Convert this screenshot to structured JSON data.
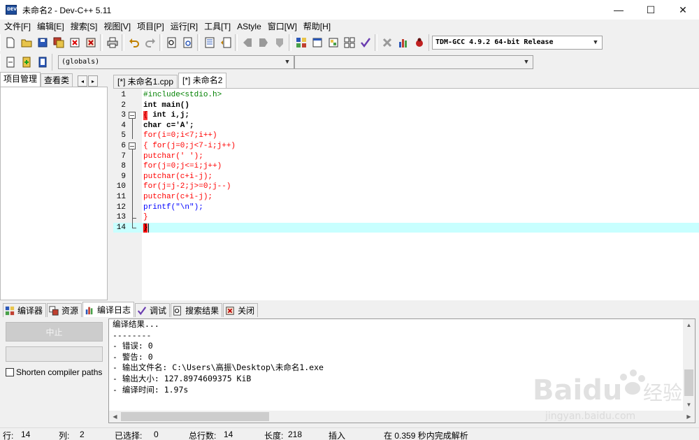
{
  "window": {
    "title": "未命名2 - Dev-C++ 5.11",
    "minimize": "—",
    "maximize": "☐",
    "close": "✕"
  },
  "menu": [
    "文件[F]",
    "编辑[E]",
    "搜索[S]",
    "视图[V]",
    "项目[P]",
    "运行[R]",
    "工具[T]",
    "AStyle",
    "窗口[W]",
    "帮助[H]"
  ],
  "toolbar": {
    "compiler_select": "TDM-GCC 4.9.2 64-bit Release",
    "globals_select": "(globals)",
    "member_select": ""
  },
  "left_panel": {
    "tabs": [
      "项目管理",
      "查看类"
    ],
    "nav_prev": "◂",
    "nav_next": "▸"
  },
  "editor_tabs": [
    "[*] 未命名1.cpp",
    "[*] 未命名2"
  ],
  "code_lines": [
    {
      "n": "1",
      "text": "#include<stdio.h>"
    },
    {
      "n": "2",
      "text": "int main()"
    },
    {
      "n": "3",
      "text": "{ int i,j;"
    },
    {
      "n": "4",
      "text": "char c='A';"
    },
    {
      "n": "5",
      "text": "for(i=0;i<7;i++)"
    },
    {
      "n": "6",
      "text": "{ for(j=0;j<7-i;j++)"
    },
    {
      "n": "7",
      "text": "putchar(' ');"
    },
    {
      "n": "8",
      "text": "for(j=0;j<=i;j++)"
    },
    {
      "n": "9",
      "text": "putchar(c+i-j);"
    },
    {
      "n": "10",
      "text": "for(j=j-2;j>=0;j--)"
    },
    {
      "n": "11",
      "text": "putchar(c+i-j);"
    },
    {
      "n": "12",
      "text": "printf(\"\\n\");"
    },
    {
      "n": "13",
      "text": "}"
    },
    {
      "n": "14",
      "text": "}"
    }
  ],
  "bottom_tabs": [
    "编译器",
    "资源",
    "编译日志",
    "调试",
    "搜索结果",
    "关闭"
  ],
  "bottom_left": {
    "abort_label": "中止",
    "shorten_paths_label": "Shorten compiler paths"
  },
  "log_lines": [
    "编译结果...",
    "--------",
    "- 错误: 0",
    "- 警告: 0",
    "- 输出文件名: C:\\Users\\高振\\Desktop\\未命名1.exe",
    "- 输出大小: 127.8974609375 KiB",
    "- 编译时间: 1.97s"
  ],
  "status": {
    "row_label": "行:",
    "row_value": "14",
    "col_label": "列:",
    "col_value": "2",
    "sel_label": "已选择:",
    "sel_value": "0",
    "lines_label": "总行数:",
    "lines_value": "14",
    "len_label": "长度:",
    "len_value": "218",
    "mode": "插入",
    "parse_info": "在 0.359 秒内完成解析"
  },
  "watermark": {
    "brand": "Baidu",
    "brand_cn": "经验",
    "url": "jingyan.baidu.com"
  },
  "colors": {
    "current_line": "#c8ffff",
    "brace_highlight": "#ff0000",
    "preprocessor": "#008000",
    "operator": "#ff0000",
    "string": "#0000ff"
  }
}
